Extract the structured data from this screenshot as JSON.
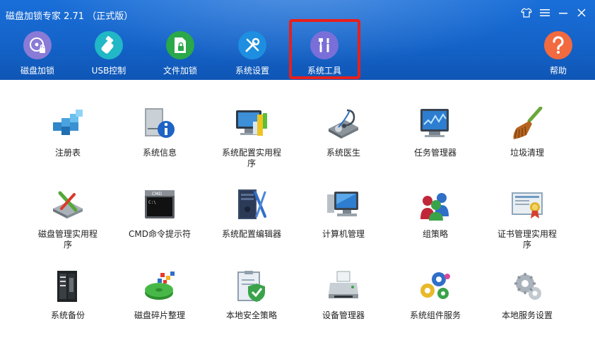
{
  "window": {
    "title": "磁盘加锁专家 2.71 （正式版）"
  },
  "nav": [
    {
      "label": "磁盘加锁",
      "icon": "disk-lock-icon",
      "color": "#8a7bd6"
    },
    {
      "label": "USB控制",
      "icon": "usb-drive-icon",
      "color": "#21b7c6"
    },
    {
      "label": "文件加锁",
      "icon": "file-lock-icon",
      "color": "#2aa84a"
    },
    {
      "label": "系统设置",
      "icon": "tools-icon",
      "color": "#1e8fe0"
    },
    {
      "label": "系统工具",
      "icon": "wrench-screwdriver-icon",
      "color": "#7a6fd8",
      "selected": true
    },
    {
      "label": "帮助",
      "icon": "question-icon",
      "color": "#f26a3f"
    }
  ],
  "tools": [
    {
      "label": "注册表",
      "icon": "registry-cubes-icon"
    },
    {
      "label": "系统信息",
      "icon": "system-info-icon"
    },
    {
      "label": "系统配置实用程\n序",
      "icon": "system-config-icon"
    },
    {
      "label": "系统医生",
      "icon": "stethoscope-icon"
    },
    {
      "label": "任务管理器",
      "icon": "task-manager-icon"
    },
    {
      "label": "垃圾清理",
      "icon": "broom-icon"
    },
    {
      "label": "磁盘管理实用程\n序",
      "icon": "disk-management-icon"
    },
    {
      "label": "CMD命令提示符",
      "icon": "cmd-icon"
    },
    {
      "label": "系统配置编辑器",
      "icon": "config-editor-icon"
    },
    {
      "label": "计算机管理",
      "icon": "computer-management-icon"
    },
    {
      "label": "组策略",
      "icon": "group-policy-icon"
    },
    {
      "label": "证书管理实用程\n序",
      "icon": "certificate-icon"
    },
    {
      "label": "系统备份",
      "icon": "server-backup-icon"
    },
    {
      "label": "磁盘碎片整理",
      "icon": "defrag-icon"
    },
    {
      "label": "本地安全策略",
      "icon": "security-policy-icon"
    },
    {
      "label": "设备管理器",
      "icon": "device-manager-icon"
    },
    {
      "label": "系统组件服务",
      "icon": "component-services-icon"
    },
    {
      "label": "本地服务设置",
      "icon": "local-services-icon"
    }
  ],
  "colors": {
    "header": "#1463c9",
    "highlight": "#e8201b"
  }
}
